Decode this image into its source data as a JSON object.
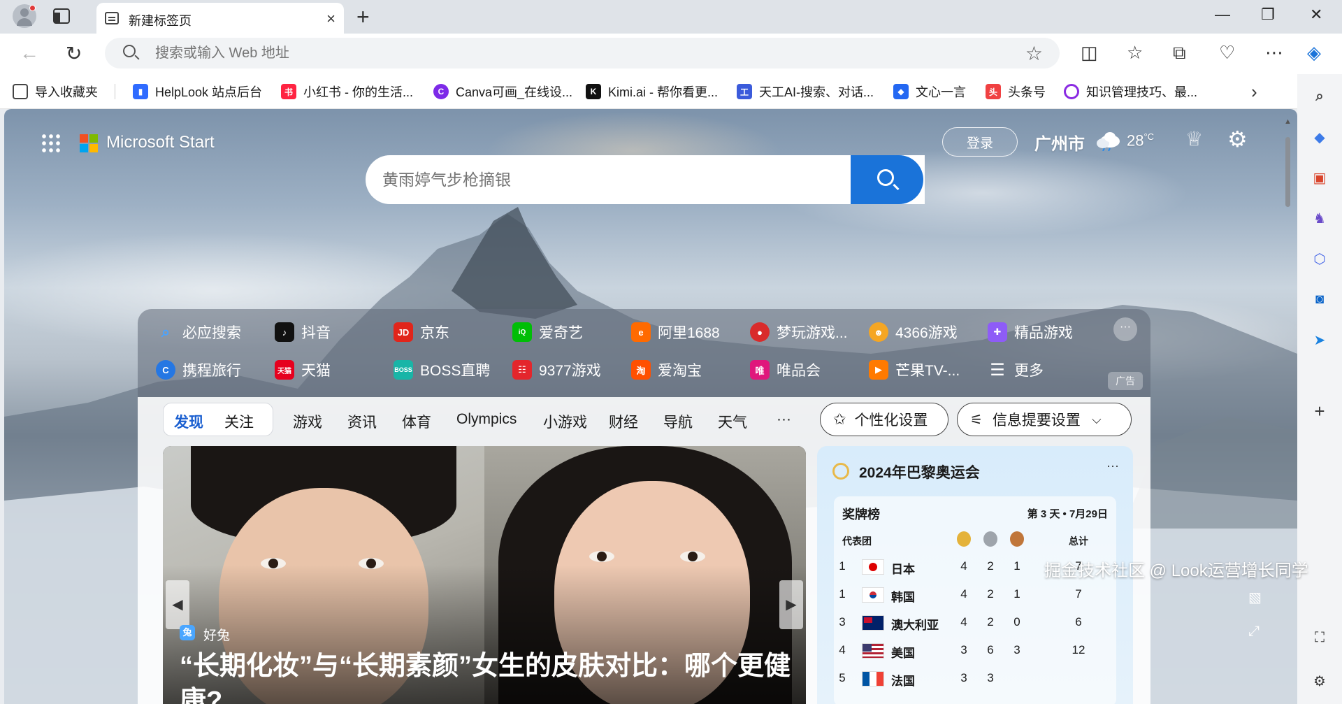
{
  "browser": {
    "tab_title": "新建标签页",
    "tab_close_glyph": "×",
    "new_tab_glyph": "+",
    "window": {
      "minimize": "—",
      "restore": "❐",
      "close": "✕"
    },
    "address_placeholder": "搜索或输入 Web 地址",
    "favorites": [
      {
        "label": "导入收藏夹",
        "icon": "import-favorites-icon",
        "color": "#444444"
      },
      {
        "label": "HelpLook 站点后台",
        "icon": "helplook-icon",
        "color": "#2f6bff"
      },
      {
        "label": "小红书 - 你的生活...",
        "icon": "xiaohongshu-icon",
        "color": "#ff2442"
      },
      {
        "label": "Canva可画_在线设...",
        "icon": "canva-icon",
        "color": "#7d2ae8"
      },
      {
        "label": "Kimi.ai - 帮你看更...",
        "icon": "kimi-icon",
        "color": "#111111"
      },
      {
        "label": "天工AI-搜索、对话...",
        "icon": "tiangong-icon",
        "color": "#3b5bdb"
      },
      {
        "label": "文心一言",
        "icon": "wenxin-icon",
        "color": "#2468f2"
      },
      {
        "label": "头条号",
        "icon": "toutiao-icon",
        "color": "#f04142"
      },
      {
        "label": "知识管理技巧、最...",
        "icon": "knowledge-icon",
        "color": "#8a2be2"
      }
    ]
  },
  "page": {
    "brand": "Microsoft Start",
    "login": "登录",
    "city": "广州市",
    "temp_value": "28",
    "temp_unit": "°C",
    "search_placeholder": "黄雨婷气步枪摘银",
    "quick_links": [
      {
        "label": "必应搜索",
        "icon": "bing-search-icon",
        "color": "#2b7cd3"
      },
      {
        "label": "抖音",
        "icon": "douyin-icon",
        "color": "#111111"
      },
      {
        "label": "京东",
        "icon": "jd-icon",
        "color": "#e1251b"
      },
      {
        "label": "爱奇艺",
        "icon": "iqiyi-icon",
        "color": "#00be06"
      },
      {
        "label": "阿里1688",
        "icon": "ali1688-icon",
        "color": "#ff6a00"
      },
      {
        "label": "梦玩游戏...",
        "icon": "mengwan-icon",
        "color": "#d92b2b"
      },
      {
        "label": "4366游戏",
        "icon": "game4366-icon",
        "color": "#f5a623"
      },
      {
        "label": "精品游戏",
        "icon": "gamepad-icon",
        "color": "#8e5cf7"
      },
      {
        "label": "携程旅行",
        "icon": "ctrip-icon",
        "color": "#2577e3"
      },
      {
        "label": "天猫",
        "icon": "tmall-icon",
        "color": "#e6001e"
      },
      {
        "label": "BOSS直聘",
        "icon": "boss-icon",
        "color": "#18b5a7"
      },
      {
        "label": "9377游戏",
        "icon": "game9377-icon",
        "color": "#e4262c"
      },
      {
        "label": "爱淘宝",
        "icon": "aitaobao-icon",
        "color": "#ff5000"
      },
      {
        "label": "唯品会",
        "icon": "vipshop-icon",
        "color": "#e0177c"
      },
      {
        "label": "芒果TV-...",
        "icon": "mango-icon",
        "color": "#ff7a00"
      },
      {
        "label": "更多",
        "icon": "menu-icon",
        "color": "transparent"
      }
    ],
    "ad_label": "广告",
    "feed_tabs": [
      "发现",
      "关注",
      "游戏",
      "资讯",
      "体育",
      "Olympics",
      "小游戏",
      "财经",
      "导航",
      "天气",
      "···"
    ],
    "personalize": "个性化设置",
    "info_settings": "信息提要设置",
    "hero": {
      "source": "好兔",
      "headline": "“长期化妆”与“长期素颜”女生的皮肤对比：哪个更健康?"
    },
    "olympics": {
      "title": "2024年巴黎奥运会",
      "more": "···",
      "medal_title": "奖牌榜",
      "date": "第 3 天 • 7月29日",
      "col_team": "代表团",
      "col_total": "总计",
      "rows": [
        {
          "rank": "1",
          "name": "日本",
          "gold": "4",
          "silver": "2",
          "bronze": "1",
          "total": "7"
        },
        {
          "rank": "1",
          "name": "韩国",
          "gold": "4",
          "silver": "2",
          "bronze": "1",
          "total": "7"
        },
        {
          "rank": "3",
          "name": "澳大利亚",
          "gold": "4",
          "silver": "2",
          "bronze": "0",
          "total": "6"
        },
        {
          "rank": "4",
          "name": "美国",
          "gold": "3",
          "silver": "6",
          "bronze": "3",
          "total": "12"
        },
        {
          "rank": "5",
          "name": "法国",
          "gold": "3",
          "silver": "3",
          "bronze": "",
          "total": ""
        }
      ]
    }
  },
  "watermark": "掘金技术社区 @ Look运营增长同学"
}
